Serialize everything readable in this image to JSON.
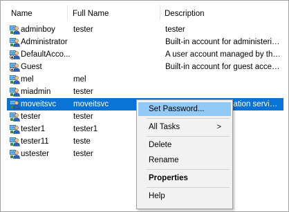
{
  "columns": {
    "name": "Name",
    "full_name": "Full Name",
    "description": "Description"
  },
  "users": [
    {
      "name": "adminboy",
      "full_name": "tester",
      "description": "tester",
      "icon": "user-icon",
      "selected": false
    },
    {
      "name": "Administrator",
      "full_name": "",
      "description": "Built-in account for administering...",
      "icon": "user-icon",
      "selected": false
    },
    {
      "name": "DefaultAcco...",
      "full_name": "",
      "description": "A user account managed by the s...",
      "icon": "disabled-user-icon",
      "selected": false
    },
    {
      "name": "Guest",
      "full_name": "",
      "description": "Built-in account for guest access t...",
      "icon": "disabled-user-icon",
      "selected": false
    },
    {
      "name": "mel",
      "full_name": "mel",
      "description": "",
      "icon": "user-icon",
      "selected": false
    },
    {
      "name": "miadmin",
      "full_name": "tester",
      "description": "",
      "icon": "user-icon",
      "selected": false
    },
    {
      "name": "moveitsvc",
      "full_name": "moveitsvc",
      "description": "The MOVEit Automation service r...",
      "icon": "user-icon",
      "selected": true
    },
    {
      "name": "tester",
      "full_name": "tester",
      "description": "",
      "icon": "user-icon",
      "selected": false
    },
    {
      "name": "tester1",
      "full_name": "tester1",
      "description": "",
      "icon": "user-icon",
      "selected": false
    },
    {
      "name": "tester11",
      "full_name": "teste",
      "description": "",
      "icon": "user-icon",
      "selected": false
    },
    {
      "name": "ustester",
      "full_name": "tester",
      "description": "",
      "icon": "user-icon",
      "selected": false
    }
  ],
  "context_menu": {
    "items": [
      {
        "label": "Set Password...",
        "highlighted": true,
        "bold": false,
        "submenu": false,
        "separator_after": true
      },
      {
        "label": "All Tasks",
        "highlighted": false,
        "bold": false,
        "submenu": true,
        "separator_after": true
      },
      {
        "label": "Delete",
        "highlighted": false,
        "bold": false,
        "submenu": false,
        "separator_after": false
      },
      {
        "label": "Rename",
        "highlighted": false,
        "bold": false,
        "submenu": false,
        "separator_after": true
      },
      {
        "label": "Properties",
        "highlighted": false,
        "bold": true,
        "submenu": false,
        "separator_after": true
      },
      {
        "label": "Help",
        "highlighted": false,
        "bold": false,
        "submenu": false,
        "separator_after": false
      }
    ],
    "submenu_arrow": ">"
  },
  "colors": {
    "selection": "#0a74d6",
    "menu_highlight": "#91c9f7",
    "menu_background": "#f2f2f2"
  }
}
